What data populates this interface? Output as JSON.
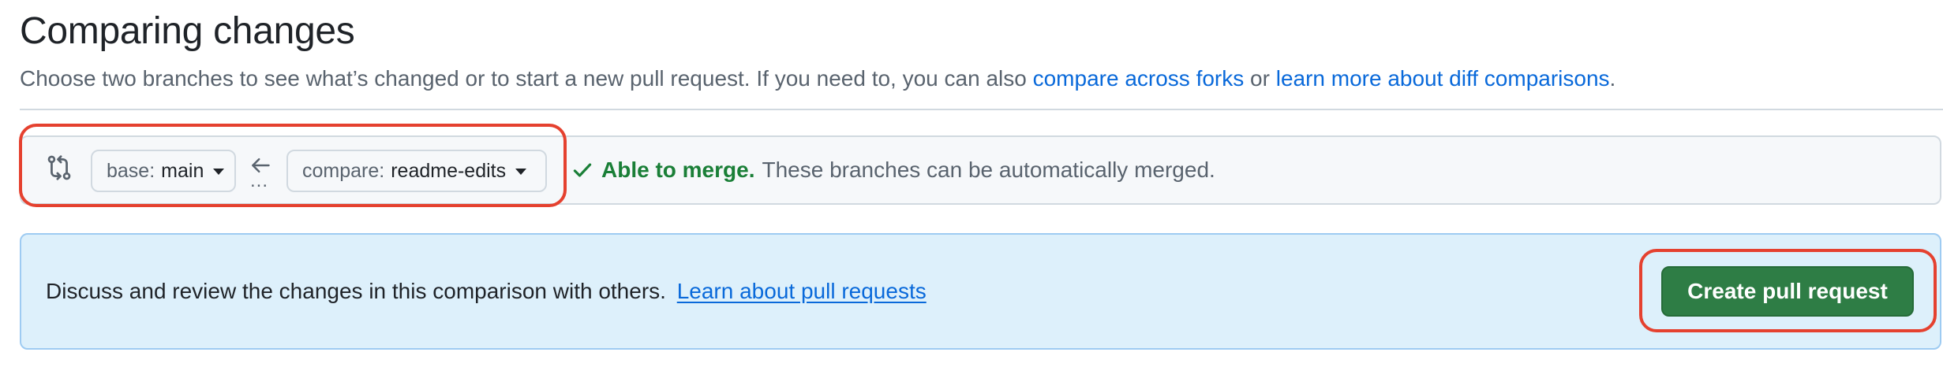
{
  "header": {
    "title": "Comparing changes",
    "description_prefix": "Choose two branches to see what’s changed or to start a new pull request. If you need to, you can also",
    "compare_forks_link": "compare across forks",
    "description_or": "or",
    "diff_link": "learn more about diff comparisons",
    "description_suffix": "."
  },
  "range_editor": {
    "icon": "git-compare-icon",
    "base": {
      "prefix": "base:",
      "branch": "main"
    },
    "arrow_icon": "arrow-left-icon",
    "ellipsis": "...",
    "compare": {
      "prefix": "compare:",
      "branch": "readme-edits"
    },
    "merge_status": {
      "icon": "check-icon",
      "status": "Able to merge.",
      "description": "These branches can be automatically merged."
    }
  },
  "info_panel": {
    "text": "Discuss and review the changes in this comparison with others.",
    "link": "Learn about pull requests",
    "button_label": "Create pull request"
  },
  "colors": {
    "link": "#0969da",
    "success": "#1a7f37",
    "primary_button": "#2e7d45",
    "info_background": "#ddf0fb",
    "highlight": "#e5412f"
  }
}
